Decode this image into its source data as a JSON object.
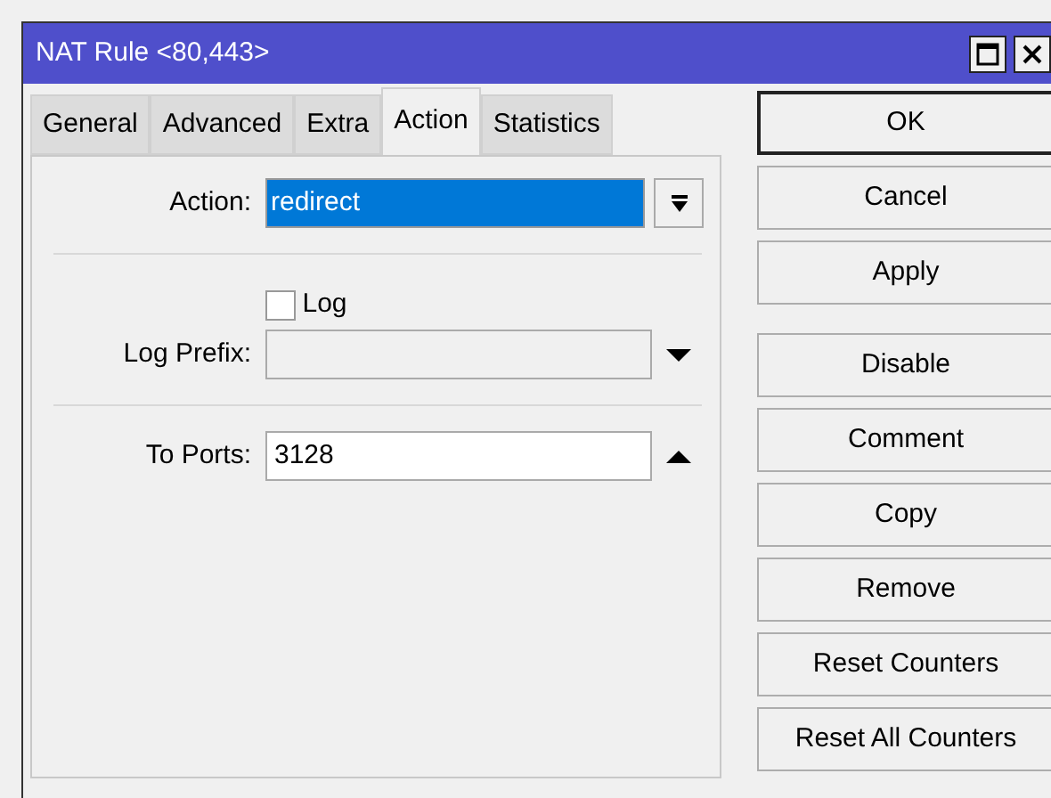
{
  "window": {
    "title": "NAT Rule <80,443>"
  },
  "tabs": [
    {
      "label": "General",
      "selected": false
    },
    {
      "label": "Advanced",
      "selected": false
    },
    {
      "label": "Extra",
      "selected": false
    },
    {
      "label": "Action",
      "selected": true
    },
    {
      "label": "Statistics",
      "selected": false
    }
  ],
  "fields": [
    {
      "kind": "dropdown",
      "label": "Action:",
      "value": "redirect",
      "highlighted": true
    },
    {
      "kind": "separator"
    },
    {
      "kind": "checkbox",
      "label": "Log",
      "checked": false
    },
    {
      "kind": "text",
      "label": "Log Prefix:",
      "disabled": true,
      "expanded": false
    },
    {
      "kind": "separator"
    },
    {
      "kind": "text",
      "label": "To Ports:",
      "value": "3128",
      "disabled": false,
      "expanded": true
    }
  ],
  "buttons": [
    "OK",
    "Cancel",
    "Apply",
    "Disable",
    "Comment",
    "Copy",
    "Remove",
    "Reset Counters",
    "Reset All Counters"
  ]
}
